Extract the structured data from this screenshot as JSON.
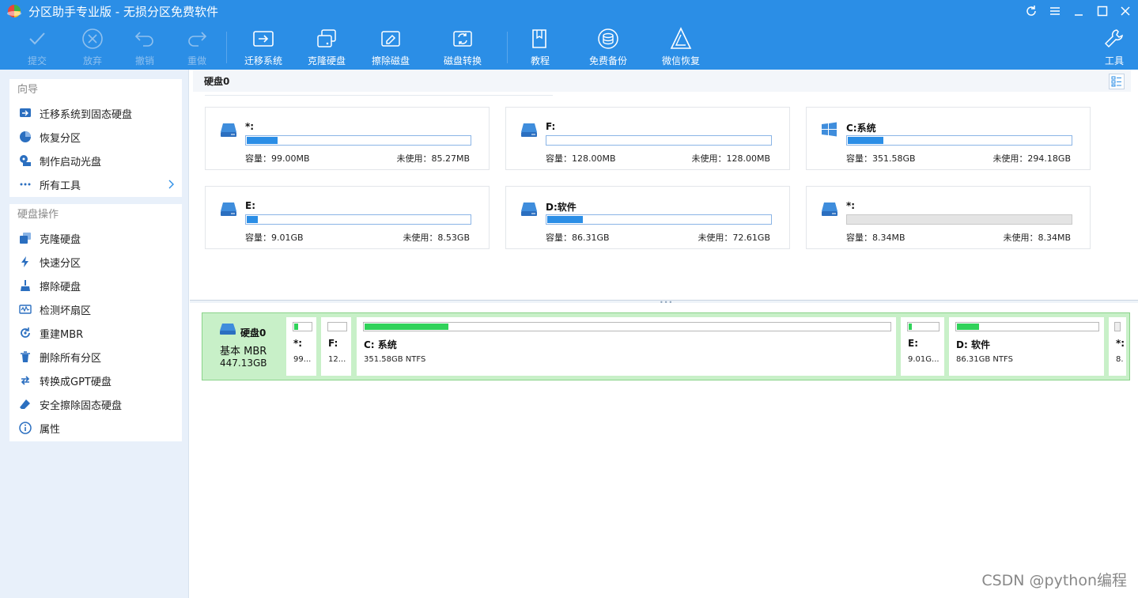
{
  "app": {
    "title": "分区助手专业版 - 无损分区免费软件"
  },
  "toolbar": {
    "items": [
      {
        "label": "提交",
        "icon": "check-icon",
        "disabled": true
      },
      {
        "label": "放弃",
        "icon": "cancel-circle-icon",
        "disabled": true
      },
      {
        "label": "撤销",
        "icon": "undo-icon",
        "disabled": true
      },
      {
        "label": "重做",
        "icon": "redo-icon",
        "disabled": true
      },
      {
        "label": "迁移系统",
        "icon": "migrate-os-icon",
        "disabled": false
      },
      {
        "label": "克隆硬盘",
        "icon": "clone-disk-icon",
        "disabled": false
      },
      {
        "label": "擦除磁盘",
        "icon": "wipe-disk-icon",
        "disabled": false
      },
      {
        "label": "磁盘转换",
        "icon": "disk-convert-icon",
        "disabled": false
      },
      {
        "label": "教程",
        "icon": "book-icon",
        "disabled": false
      },
      {
        "label": "免费备份",
        "icon": "backup-icon",
        "disabled": false
      },
      {
        "label": "微信恢复",
        "icon": "recovery-icon",
        "disabled": false
      },
      {
        "label": "工具",
        "icon": "wrench-icon",
        "disabled": false
      }
    ]
  },
  "sidebar": {
    "wizard": {
      "title": "向导",
      "items": [
        {
          "label": "迁移系统到固态硬盘",
          "icon": "migrate-ssd-icon"
        },
        {
          "label": "恢复分区",
          "icon": "pie-icon"
        },
        {
          "label": "制作启动光盘",
          "icon": "boot-disc-icon"
        },
        {
          "label": "所有工具",
          "icon": "more-dots-icon"
        }
      ]
    },
    "disk_ops": {
      "title": "硬盘操作",
      "items": [
        {
          "label": "克隆硬盘",
          "icon": "clone-icon"
        },
        {
          "label": "快速分区",
          "icon": "lightning-icon"
        },
        {
          "label": "擦除硬盘",
          "icon": "broom-icon"
        },
        {
          "label": "检测坏扇区",
          "icon": "scan-icon"
        },
        {
          "label": "重建MBR",
          "icon": "rebuild-icon"
        },
        {
          "label": "删除所有分区",
          "icon": "trash-icon"
        },
        {
          "label": "转换成GPT硬盘",
          "icon": "convert-icon"
        },
        {
          "label": "安全擦除固态硬盘",
          "icon": "eraser-icon"
        },
        {
          "label": "属性",
          "icon": "info-icon"
        }
      ]
    }
  },
  "disk": {
    "header": "硬盘0",
    "cards": [
      {
        "name": "*:",
        "capacity": "容量：99.00MB",
        "free": "未使用：85.27MB",
        "used_fraction": 0.14,
        "icon": "drive-icon"
      },
      {
        "name": "F:",
        "capacity": "容量：128.00MB",
        "free": "未使用：128.00MB",
        "used_fraction": 0.0,
        "icon": "drive-icon"
      },
      {
        "name": "C:系统",
        "capacity": "容量：351.58GB",
        "free": "未使用：294.18GB",
        "used_fraction": 0.16,
        "icon": "windows-icon"
      },
      {
        "name": "E:",
        "capacity": "容量：9.01GB",
        "free": "未使用：8.53GB",
        "used_fraction": 0.05,
        "icon": "drive-icon"
      },
      {
        "name": "D:软件",
        "capacity": "容量：86.31GB",
        "free": "未使用：72.61GB",
        "used_fraction": 0.16,
        "icon": "drive-icon"
      },
      {
        "name": "*:",
        "capacity": "容量：8.34MB",
        "free": "未使用：8.34MB",
        "used_fraction": 0.0,
        "icon": "drive-icon",
        "unallocated": true
      }
    ]
  },
  "diskmap": {
    "name": "硬盘0",
    "type": "基本 MBR",
    "size": "447.13GB",
    "partitions": [
      {
        "name": "*:",
        "info": "99...",
        "used_fraction": 0.25
      },
      {
        "name": "F:",
        "info": "12...",
        "used_fraction": 0.0
      },
      {
        "name": "C: 系统",
        "info": "351.58GB NTFS",
        "used_fraction": 0.16
      },
      {
        "name": "E:",
        "info": "9.01G...",
        "used_fraction": 0.1
      },
      {
        "name": "D: 软件",
        "info": "86.31GB NTFS",
        "used_fraction": 0.16
      },
      {
        "name": "*:",
        "info": "8.",
        "used_fraction": 0.0
      }
    ]
  },
  "watermark": "CSDN @python编程"
}
